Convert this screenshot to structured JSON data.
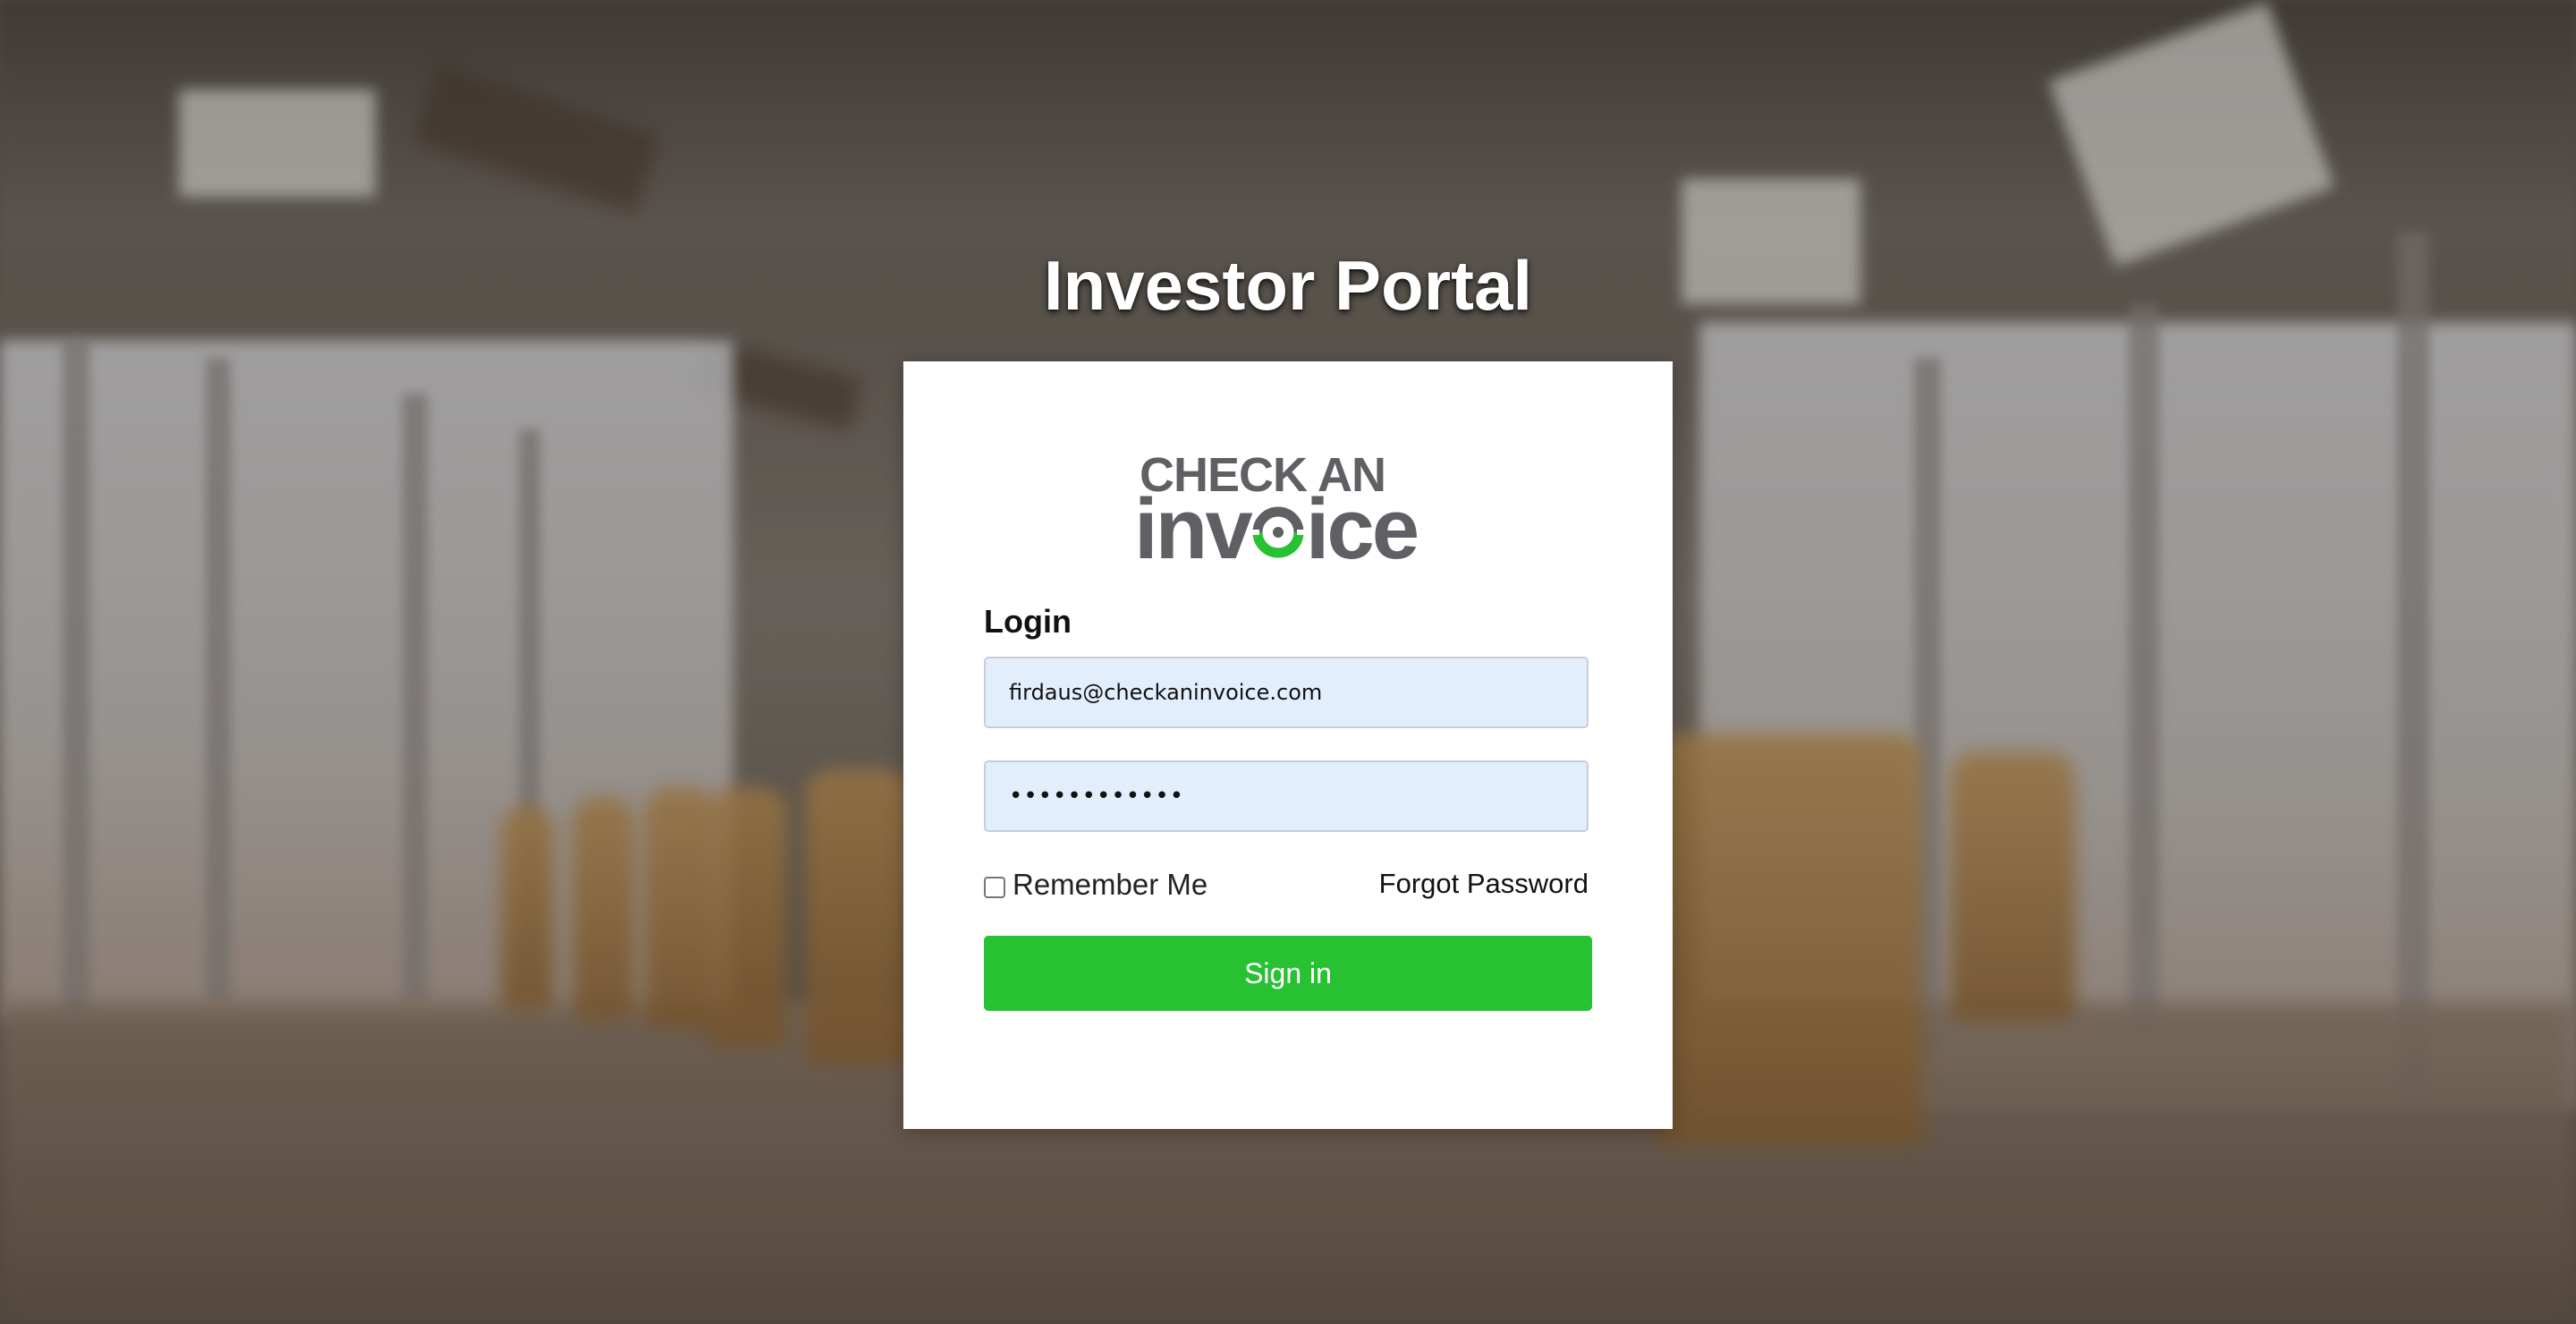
{
  "page": {
    "title": "Investor Portal"
  },
  "logo": {
    "line1": "CHECK AN",
    "line2_prefix": "inv",
    "line2_suffix": "ice",
    "brand_gray": "#5f6064",
    "brand_green": "#27c132"
  },
  "login_form": {
    "heading": "Login",
    "email_value": "firdaus@checkaninvoice.com",
    "password_value": "••••••••••••",
    "remember_label": "Remember Me",
    "remember_checked": false,
    "forgot_label": "Forgot Password",
    "submit_label": "Sign in",
    "input_bg": "#e3eefc",
    "button_color": "#27c132"
  },
  "icons": {
    "logo_o": "target-ring-icon"
  }
}
